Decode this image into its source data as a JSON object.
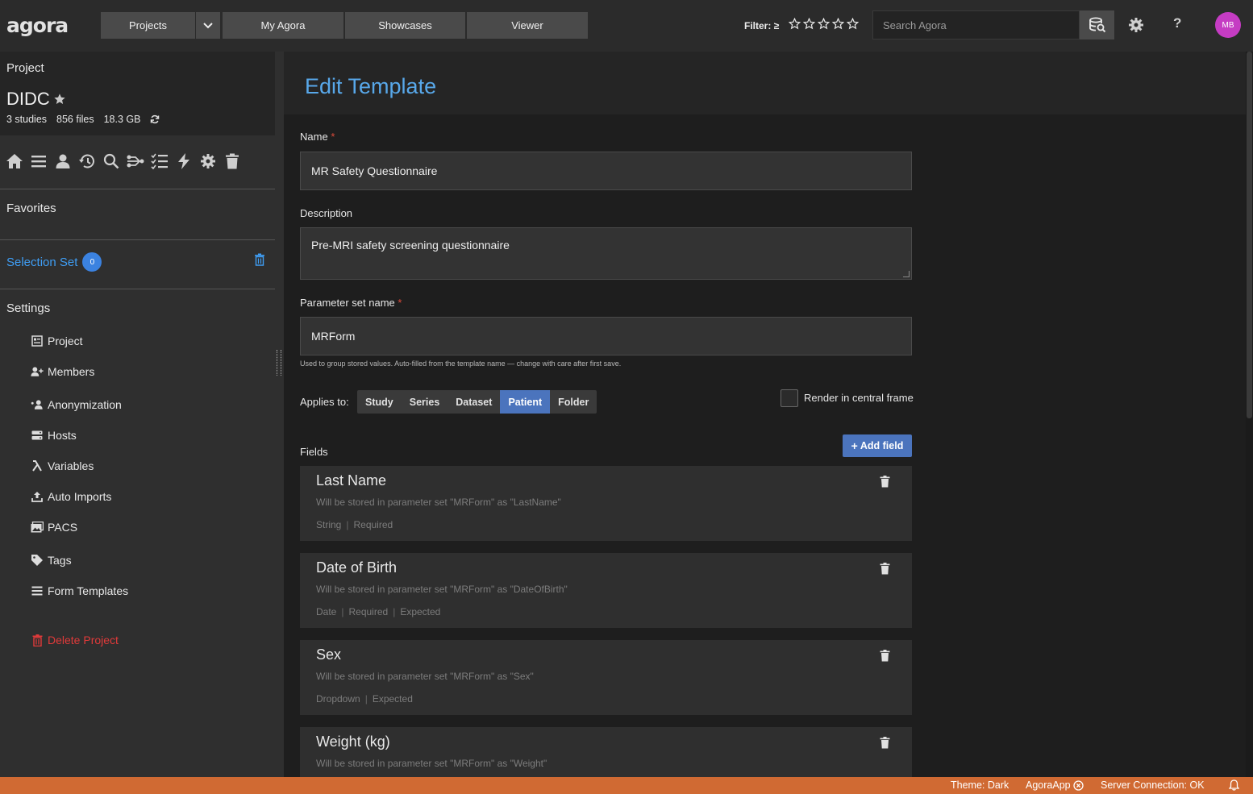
{
  "app": {
    "logo": "agora"
  },
  "topnav": {
    "projects": "Projects",
    "my_agora": "My Agora",
    "showcases": "Showcases",
    "viewer": "Viewer",
    "filter_label": "Filter: ≥",
    "filter_rating": 0,
    "filter_max": 5,
    "search_placeholder": "Search Agora",
    "avatar_initials": "MB",
    "help": "?"
  },
  "project": {
    "label": "Project",
    "name": "DIDC",
    "studies": "3 studies",
    "files": "856 files",
    "size": "18.3 GB"
  },
  "toolbar_icons": [
    "home-icon",
    "list-icon",
    "user-icon",
    "history-icon",
    "search-icon",
    "workflow-icon",
    "tasks-icon",
    "bolt-icon",
    "gear-icon",
    "trash-icon"
  ],
  "sidebar": {
    "favorites": "Favorites",
    "selection_set": "Selection Set",
    "selection_count": "0",
    "settings": "Settings",
    "items": [
      {
        "label": "Project",
        "icon": "project-icon"
      },
      {
        "label": "Members",
        "icon": "user-plus-icon"
      },
      {
        "label": "Anonymization",
        "icon": "anonymization-icon"
      },
      {
        "label": "Hosts",
        "icon": "hosts-icon"
      },
      {
        "label": "Variables",
        "icon": "lambda-icon"
      },
      {
        "label": "Auto Imports",
        "icon": "upload-icon"
      },
      {
        "label": "PACS",
        "icon": "pacs-icon"
      },
      {
        "label": "Tags",
        "icon": "tag-icon"
      },
      {
        "label": "Form Templates",
        "icon": "list-icon"
      }
    ],
    "delete_project": "Delete Project"
  },
  "main": {
    "title": "Edit Template",
    "name_label": "Name",
    "name_value": "MR Safety Questionnaire",
    "description_label": "Description",
    "description_value": "Pre-MRI safety screening questionnaire",
    "param_label": "Parameter set name",
    "param_value": "MRForm",
    "param_hint": "Used to group stored values. Auto-filled from the template name — change with care after first save.",
    "applies_label": "Applies to:",
    "applies_options": [
      "Study",
      "Series",
      "Dataset",
      "Patient",
      "Folder"
    ],
    "applies_selected": "Patient",
    "render_label": "Render in central frame",
    "render_checked": false,
    "fields_label": "Fields",
    "add_field": "Add field",
    "required_mark": "*",
    "fields": [
      {
        "title": "Last Name",
        "desc": "Will be stored in parameter set \"MRForm\" as \"LastName\"",
        "tags": [
          "String",
          "Required"
        ]
      },
      {
        "title": "Date of Birth",
        "desc": "Will be stored in parameter set \"MRForm\" as \"DateOfBirth\"",
        "tags": [
          "Date",
          "Required",
          "Expected"
        ]
      },
      {
        "title": "Sex",
        "desc": "Will be stored in parameter set \"MRForm\" as \"Sex\"",
        "tags": [
          "Dropdown",
          "Expected"
        ]
      },
      {
        "title": "Weight (kg)",
        "desc": "Will be stored in parameter set \"MRForm\" as \"Weight\"",
        "tags": []
      }
    ]
  },
  "statusbar": {
    "theme": "Theme: Dark",
    "app": "AgoraApp",
    "server": "Server Connection: OK"
  },
  "colors": {
    "accent": "#4b74bd",
    "title": "#58a8ea",
    "status": "#d06a33",
    "danger": "#e03a3a",
    "link": "#3f9ef5"
  }
}
